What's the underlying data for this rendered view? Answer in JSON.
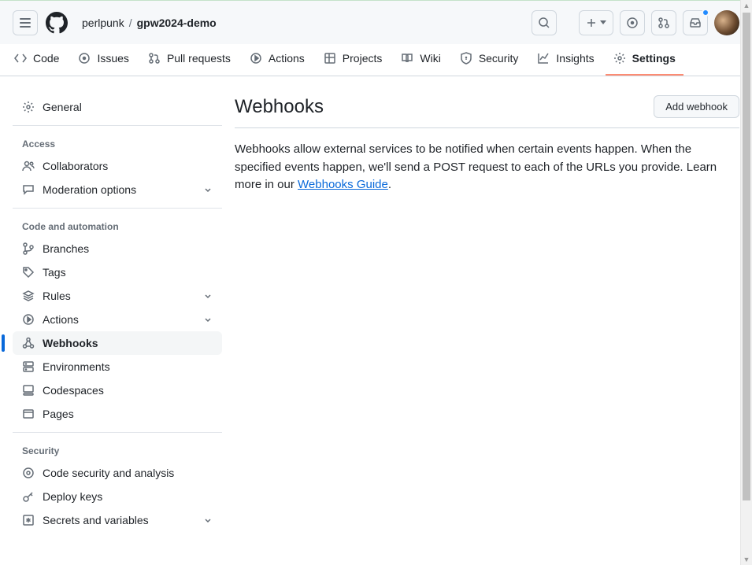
{
  "breadcrumb": {
    "owner": "perlpunk",
    "sep": "/",
    "repo": "gpw2024-demo"
  },
  "tabs": {
    "code": "Code",
    "issues": "Issues",
    "pulls": "Pull requests",
    "actions": "Actions",
    "projects": "Projects",
    "wiki": "Wiki",
    "security": "Security",
    "insights": "Insights",
    "settings": "Settings"
  },
  "sidebar": {
    "general": "General",
    "groups": {
      "access": {
        "header": "Access",
        "collaborators": "Collaborators",
        "moderation": "Moderation options"
      },
      "code": {
        "header": "Code and automation",
        "branches": "Branches",
        "tags": "Tags",
        "rules": "Rules",
        "actions": "Actions",
        "webhooks": "Webhooks",
        "environments": "Environments",
        "codespaces": "Codespaces",
        "pages": "Pages"
      },
      "security": {
        "header": "Security",
        "codesec": "Code security and analysis",
        "deploykeys": "Deploy keys",
        "secrets": "Secrets and variables"
      }
    }
  },
  "page": {
    "title": "Webhooks",
    "add_button": "Add webhook",
    "description_head": "Webhooks allow external services to be notified when certain events happen. When the specified events happen, we'll send a POST request to each of the URLs you provide. Learn more in our ",
    "guide_link": "Webhooks Guide",
    "description_tail": "."
  }
}
